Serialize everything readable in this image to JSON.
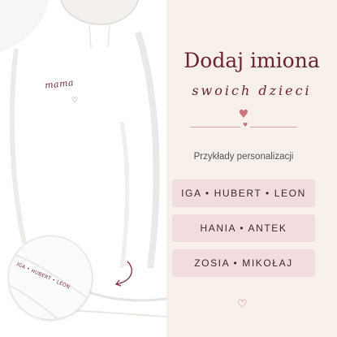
{
  "product": {
    "embroidery_text": "mama",
    "sleeve_text": "IGA • HUBERT • LEON"
  },
  "panel": {
    "title": "Dodaj imiona",
    "subtitle": "swoich dzieci",
    "examples_label": "Przykłady personalizacji",
    "examples": [
      "IGA • HUBERT • LEON",
      "HANIA • ANTEK",
      "ZOSIA • MIKOŁAJ"
    ]
  },
  "icons": {
    "heart_main": "heart-icon",
    "divider_heart": "heart-icon",
    "bottom_heart": "heart-outline-icon",
    "arrow": "curved-arrow-icon"
  },
  "colors": {
    "accent": "#6b2530",
    "heart": "#c97377",
    "pill_bg": "#f1dddd",
    "background": "#f6efea"
  }
}
